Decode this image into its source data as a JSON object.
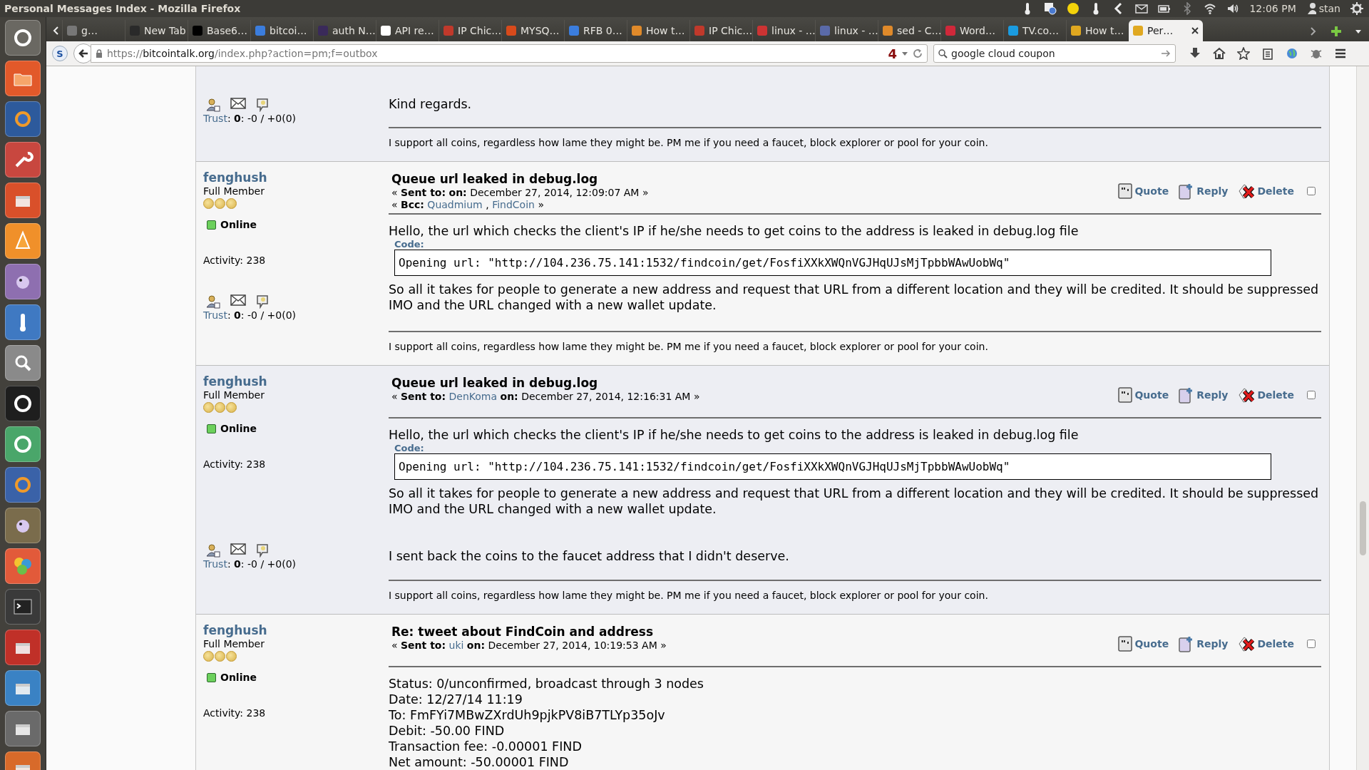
{
  "panel": {
    "title": "Personal Messages Index - Mozilla Firefox",
    "time": "12:06 PM",
    "user": "stan"
  },
  "tabs": [
    {
      "label": "g…",
      "selected": false
    },
    {
      "label": "New Tab",
      "selected": false
    },
    {
      "label": "Base6…",
      "selected": false
    },
    {
      "label": "bitcoi…",
      "selected": false
    },
    {
      "label": "auth N…",
      "selected": false
    },
    {
      "label": "API re…",
      "selected": false
    },
    {
      "label": "IP Chic…",
      "selected": false
    },
    {
      "label": "MYSQ…",
      "selected": false
    },
    {
      "label": "RFB 0…",
      "selected": false
    },
    {
      "label": "How t…",
      "selected": false
    },
    {
      "label": "IP Chic…",
      "selected": false
    },
    {
      "label": "linux - …",
      "selected": false
    },
    {
      "label": "linux - …",
      "selected": false
    },
    {
      "label": "sed - C…",
      "selected": false
    },
    {
      "label": "Word…",
      "selected": false
    },
    {
      "label": "TV.co…",
      "selected": false
    },
    {
      "label": "How t…",
      "selected": false
    },
    {
      "label": "Per…",
      "selected": true
    }
  ],
  "navbar": {
    "addon_badge": "S",
    "url": {
      "scheme": "https://",
      "host": "bitcointalk.org",
      "path": "/index.php?action=pm;f=outbox"
    },
    "url_badge": "4",
    "search": {
      "value": "google cloud coupon"
    }
  },
  "posts": [
    {
      "trust": {
        "link": "Trust",
        "text": ": **0**: -0 / +0(0)"
      },
      "body": [
        {
          "kind": "text",
          "text": "Kind regards."
        }
      ],
      "signature": "I support all coins, regardless how lame they might be. PM me if you need a faucet, block explorer or pool for your coin."
    },
    {
      "author": {
        "name": "fenghush",
        "rank": "Full Member",
        "stars": 3,
        "online": true,
        "status": "Online",
        "activity": "Activity: 238"
      },
      "trust": {
        "link": "Trust",
        "text": ": **0**: -0 / +0(0)"
      },
      "subject": "Queue url leaked in debug.log",
      "sent": {
        "open": "«",
        "label": "Sent to:",
        "on": "on:",
        "date": "December 27, 2014, 12:09:07 AM",
        "close": "»"
      },
      "bcc": {
        "open": "«",
        "label": "Bcc:",
        "recipients": [
          "Quadmium",
          "FindCoin"
        ],
        "separator": ",",
        "close": "»"
      },
      "actions": [
        {
          "kind": "quote",
          "label": "Quote"
        },
        {
          "kind": "reply",
          "label": "Reply"
        },
        {
          "kind": "delete",
          "label": "Delete"
        }
      ],
      "checked": false,
      "body": [
        {
          "kind": "text",
          "text": "Hello, the url which checks the client's IP if he/she needs to get coins to the address is leaked in debug.log file"
        },
        {
          "kind": "code",
          "label": "Code:",
          "text": "Opening url: \"http://104.236.75.141:1532/findcoin/get/FosfiXXkXWQnVGJHqUJsMjTpbbWAwUobWq\""
        },
        {
          "kind": "text",
          "text": "So all it takes for people to generate a new address and request that URL from a different location and they will be credited. It should be suppressed IMO and the URL changed with a new wallet update."
        }
      ],
      "signature": "I support all coins, regardless how lame they might be. PM me if you need a faucet, block explorer or pool for your coin."
    },
    {
      "author": {
        "name": "fenghush",
        "rank": "Full Member",
        "stars": 3,
        "online": true,
        "status": "Online",
        "activity": "Activity: 238"
      },
      "trust": {
        "link": "Trust",
        "text": ": **0**: -0 / +0(0)"
      },
      "subject": "Queue url leaked in debug.log",
      "sent": {
        "open": "«",
        "label": "Sent to:",
        "recipients": [
          "DenKoma"
        ],
        "on": "on:",
        "date": "December 27, 2014, 12:16:31 AM",
        "close": "»"
      },
      "actions": [
        {
          "kind": "quote",
          "label": "Quote"
        },
        {
          "kind": "reply",
          "label": "Reply"
        },
        {
          "kind": "delete",
          "label": "Delete"
        }
      ],
      "checked": false,
      "body": [
        {
          "kind": "text",
          "text": "Hello, the url which checks the client's IP if he/she needs to get coins to the address is leaked in debug.log file"
        },
        {
          "kind": "code",
          "label": "Code:",
          "text": "Opening url: \"http://104.236.75.141:1532/findcoin/get/FosfiXXkXWQnVGJHqUJsMjTpbbWAwUobWq\""
        },
        {
          "kind": "text",
          "text": "So all it takes for people to generate a new address and request that URL from a different location and they will be credited. It should be suppressed IMO and the URL changed with a new wallet update."
        },
        {
          "kind": "text",
          "text": "I sent back the coins to the faucet address that I didn't deserve."
        }
      ],
      "signature": "I support all coins, regardless how lame they might be. PM me if you need a faucet, block explorer or pool for your coin."
    },
    {
      "author": {
        "name": "fenghush",
        "rank": "Full Member",
        "stars": 3,
        "online": true,
        "status": "Online",
        "activity": "Activity: 238"
      },
      "subject": "Re: tweet about FindCoin and address",
      "sent": {
        "open": "«",
        "label": "Sent to:",
        "recipients": [
          "uki"
        ],
        "on": "on:",
        "date": "December 27, 2014, 10:19:53 AM",
        "close": "»"
      },
      "actions": [
        {
          "kind": "quote",
          "label": "Quote"
        },
        {
          "kind": "reply",
          "label": "Reply"
        },
        {
          "kind": "delete",
          "label": "Delete"
        }
      ],
      "checked": false,
      "body": [
        {
          "kind": "lines",
          "lines": [
            "Status: 0/unconfirmed, broadcast through 3 nodes",
            "Date: 12/27/14 11:19",
            "To: FmFYi7MBwZXrdUh9pjkPV8iB7TLYp35oJv",
            "Debit: -50.00 FIND",
            "Transaction fee: -0.00001 FIND",
            "Net amount: -50.00001 FIND"
          ]
        }
      ]
    }
  ]
}
